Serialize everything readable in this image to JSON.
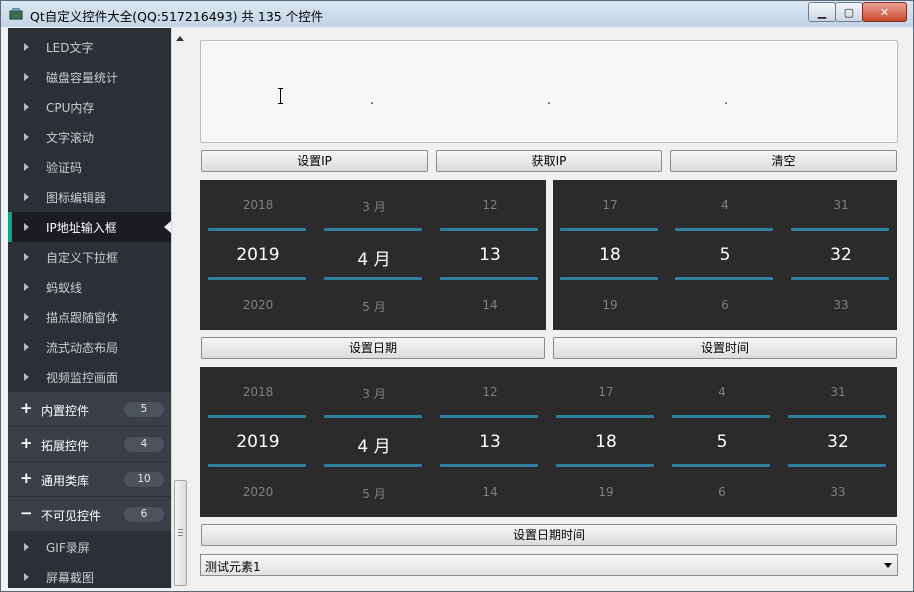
{
  "window": {
    "title": "Qt自定义控件大全(QQ:517216493) 共 135 个控件"
  },
  "sidebar": {
    "items_top": [
      {
        "label": "LED文字"
      },
      {
        "label": "磁盘容量统计"
      },
      {
        "label": "CPU内存"
      },
      {
        "label": "文字滚动"
      },
      {
        "label": "验证码"
      },
      {
        "label": "图标编辑器"
      },
      {
        "label": "IP地址输入框",
        "active": true
      },
      {
        "label": "自定义下拉框"
      },
      {
        "label": "蚂蚁线"
      },
      {
        "label": "描点跟随窗体"
      },
      {
        "label": "流式动态布局"
      },
      {
        "label": "视频监控画面"
      }
    ],
    "groups": [
      {
        "symbol": "+",
        "label": "内置控件",
        "count": "5"
      },
      {
        "symbol": "+",
        "label": "拓展控件",
        "count": "4"
      },
      {
        "symbol": "+",
        "label": "通用类库",
        "count": "10"
      },
      {
        "symbol": "−",
        "label": "不可见控件",
        "count": "6"
      }
    ],
    "items_bottom": [
      {
        "label": "GIF录屏"
      },
      {
        "label": "屏幕截图"
      }
    ]
  },
  "ip": {
    "dots": [
      ".",
      ".",
      "."
    ]
  },
  "buttons": {
    "set_ip": "设置IP",
    "get_ip": "获取IP",
    "clear": "清空",
    "set_date": "设置日期",
    "set_time": "设置时间",
    "set_datetime": "设置日期时间"
  },
  "date_picker": [
    {
      "top": "2018",
      "mid": "2019",
      "bot": "2020"
    },
    {
      "top": "3 月",
      "mid": "4 月",
      "bot": "5 月"
    },
    {
      "top": "12",
      "mid": "13",
      "bot": "14"
    }
  ],
  "time_picker": [
    {
      "top": "17",
      "mid": "18",
      "bot": "19"
    },
    {
      "top": "4",
      "mid": "5",
      "bot": "6"
    },
    {
      "top": "31",
      "mid": "32",
      "bot": "33"
    }
  ],
  "datetime_picker": [
    {
      "top": "2018",
      "mid": "2019",
      "bot": "2020"
    },
    {
      "top": "3 月",
      "mid": "4 月",
      "bot": "5 月"
    },
    {
      "top": "12",
      "mid": "13",
      "bot": "14"
    },
    {
      "top": "17",
      "mid": "18",
      "bot": "19"
    },
    {
      "top": "4",
      "mid": "5",
      "bot": "6"
    },
    {
      "top": "31",
      "mid": "32",
      "bot": "33"
    }
  ],
  "combo": {
    "value": "测试元素1"
  },
  "colors": {
    "sidebar_bg": "#2b2f36",
    "picker_bg": "#2b2b2c",
    "picker_line": "#2f7f9e",
    "active_bar": "#16a085"
  }
}
